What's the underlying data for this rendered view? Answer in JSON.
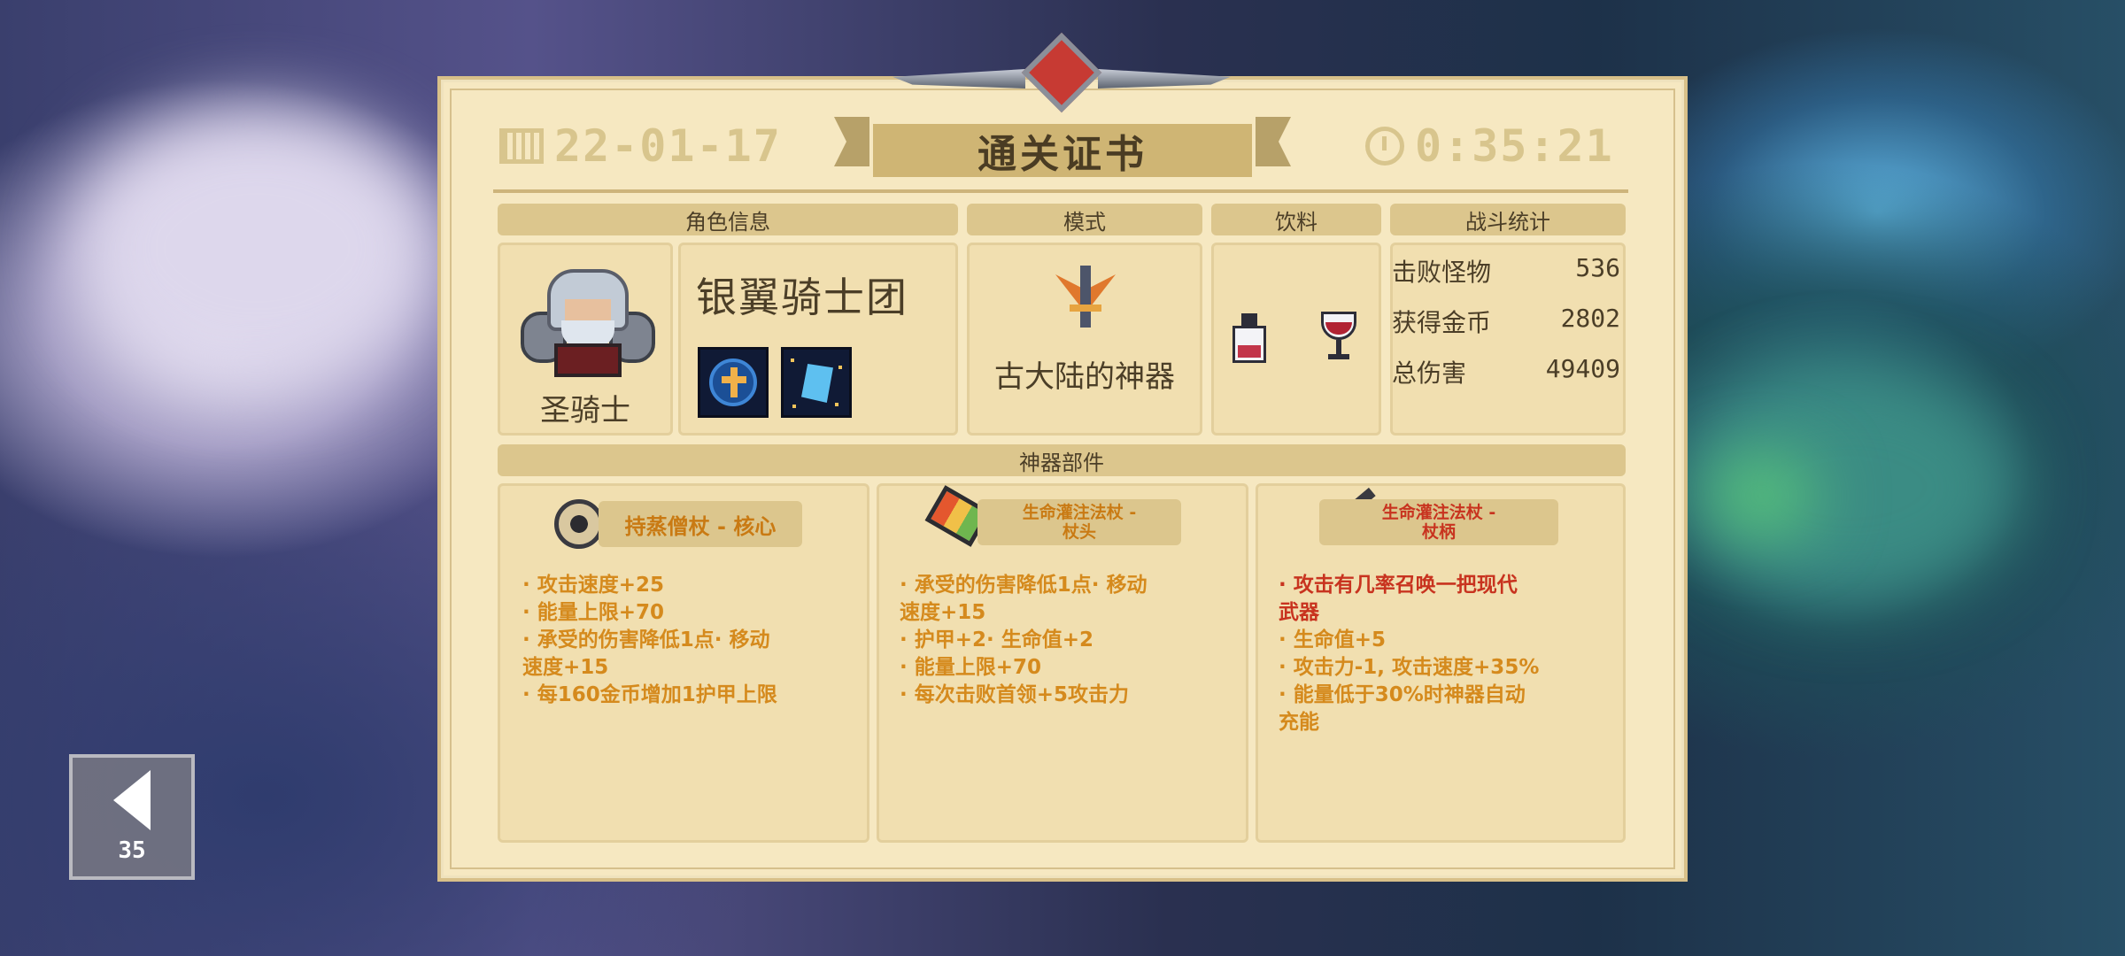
{
  "back": {
    "count": "35"
  },
  "certificate": {
    "title": "通关证书",
    "date": "22-01-17",
    "time": "0:35:21"
  },
  "headers": {
    "character": "角色信息",
    "mode": "模式",
    "drink": "饮料",
    "battle": "战斗统计",
    "parts": "神器部件"
  },
  "character": {
    "class_name": "圣骑士",
    "skin_name": "银翼骑士团",
    "skills": [
      "shield-cross-skill-icon",
      "crystal-shard-skill-icon"
    ]
  },
  "mode": {
    "name": "古大陆的神器"
  },
  "drinks": [
    "milk-bottle-icon",
    "red-wine-glass-icon"
  ],
  "battle_stats": [
    {
      "label": "击败怪物",
      "value": "536"
    },
    {
      "label": "获得金币",
      "value": "2802"
    },
    {
      "label": "总伤害",
      "value": "49409"
    }
  ],
  "parts": [
    {
      "name": "持蒸僧杖 - 核心",
      "icon": "core-orb-icon",
      "color": "#c97a13",
      "lines": [
        "· 攻击速度+25",
        "· 能量上限+70",
        "· 承受的伤害降低1点· 移动\n速度+15",
        "· 每160金币增加1护甲上限"
      ]
    },
    {
      "name": "生命灌注法杖 -\n杖头",
      "icon": "staff-head-icon",
      "color": "#c97a13",
      "lines": [
        "· 承受的伤害降低1点· 移动\n速度+15",
        "· 护甲+2· 生命值+2",
        "· 能量上限+70",
        "· 每次击败首领+5攻击力"
      ]
    },
    {
      "name": "生命灌注法杖 -\n杖柄",
      "icon": "staff-handle-icon",
      "color": "#c8331f",
      "lines": [
        "· 攻击有几率召唤一把现代\n武器",
        "· 生命值+5",
        "· 攻击力-1, 攻击速度+35%",
        "· 能量低于30%时神器自动\n充能"
      ]
    }
  ]
}
